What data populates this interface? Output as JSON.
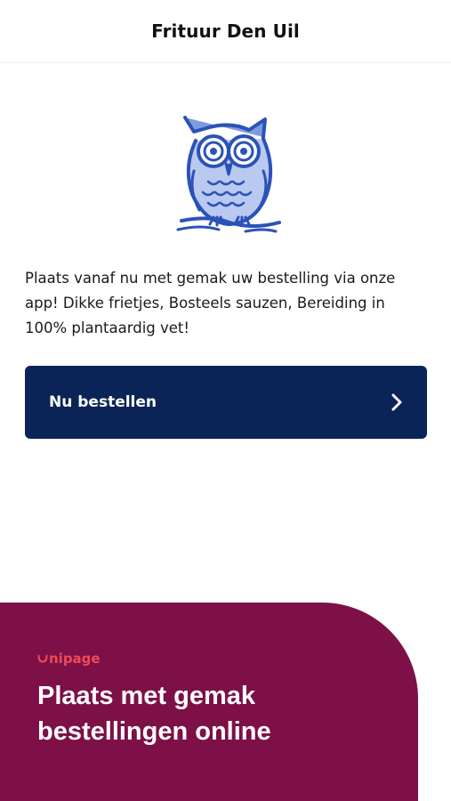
{
  "header": {
    "title": "Frituur Den Uil"
  },
  "logo": {
    "icon": "owl-logo-icon",
    "color": "#2b52b8"
  },
  "intro": {
    "text": "Plaats vanaf nu met gemak uw bestelling via onze app! Dikke frietjes, Bosteels sauzen, Bereiding in 100% plantaardig vet!"
  },
  "order_button": {
    "label": "Nu bestellen",
    "icon": "chevron-right-icon",
    "color": "#0b2457"
  },
  "promo": {
    "brand": "nipage",
    "brand_icon": "unipage-u-icon",
    "brand_color": "#ee4b56",
    "background": "#7d1047",
    "headline_line1": "Plaats met gemak",
    "headline_line2": "bestellingen online"
  }
}
